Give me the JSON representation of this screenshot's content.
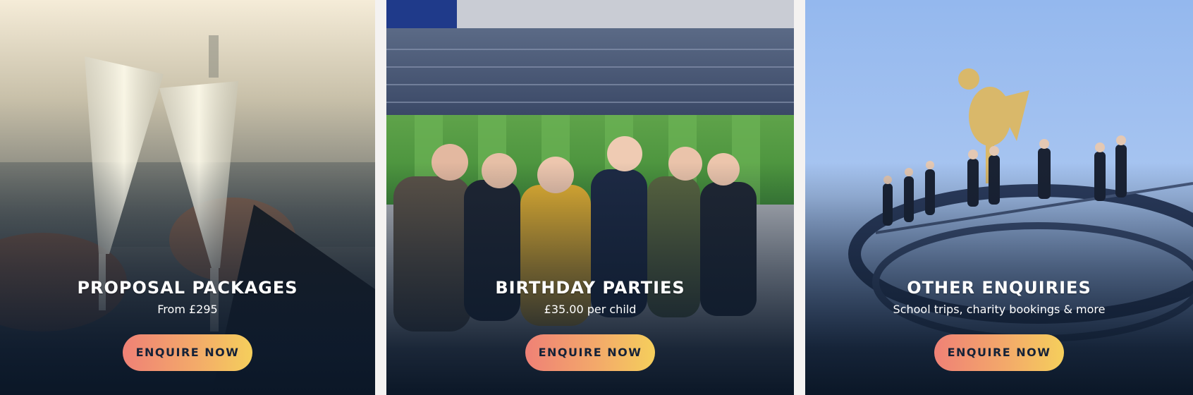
{
  "cards": [
    {
      "title": "PROPOSAL PACKAGES",
      "subtitle": "From £295",
      "cta": "ENQUIRE NOW"
    },
    {
      "title": "BIRTHDAY PARTIES",
      "subtitle": "£35.00 per child",
      "cta": "ENQUIRE NOW"
    },
    {
      "title": "OTHER ENQUIRIES",
      "subtitle": "School trips, charity bookings & more",
      "cta": "ENQUIRE NOW"
    }
  ],
  "colors": {
    "cta_gradient_start": "#ef8176",
    "cta_gradient_end": "#f5cf5c",
    "cta_text": "#152238",
    "overlay_dark": "#0b1727"
  }
}
